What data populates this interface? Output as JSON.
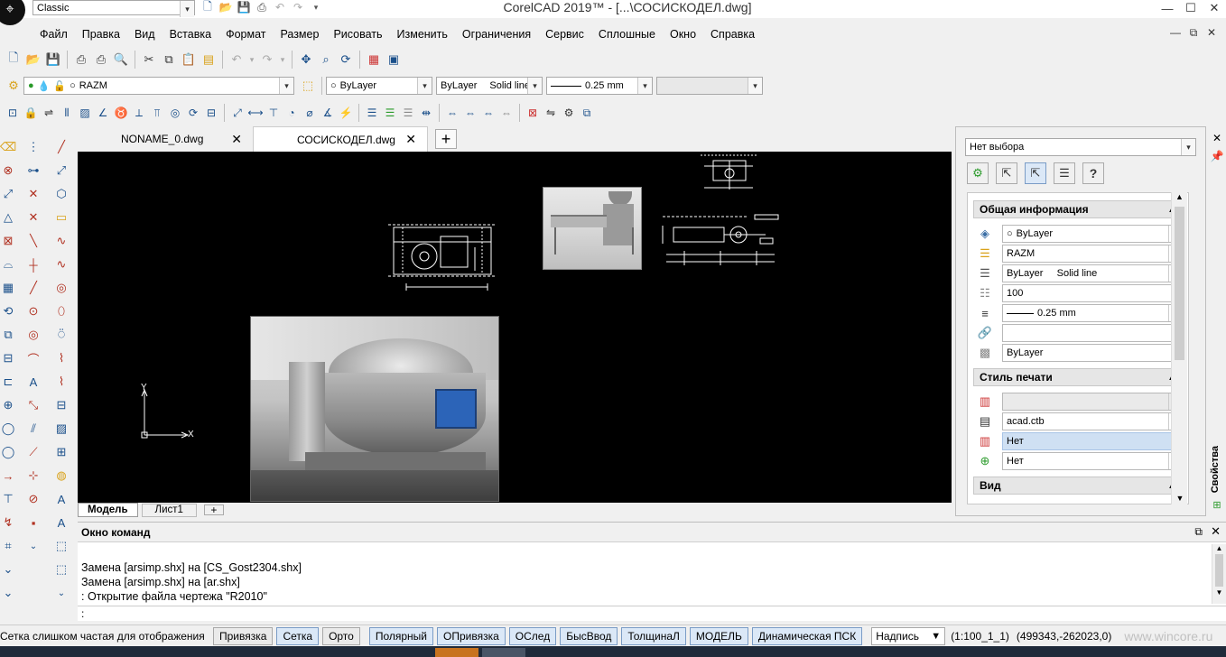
{
  "window": {
    "title": "CorelCAD 2019™ - [...\\СОСИСКОДЕЛ.dwg]",
    "workspace": "Classic",
    "controls": [
      "—",
      "☐",
      "✕"
    ],
    "doc_controls": [
      "—",
      "⧉",
      "✕"
    ]
  },
  "menu": [
    "Файл",
    "Правка",
    "Вид",
    "Вставка",
    "Формат",
    "Размер",
    "Рисовать",
    "Изменить",
    "Ограничения",
    "Сервис",
    "Сплошные",
    "Окно",
    "Справка"
  ],
  "layer_toolbar": {
    "layer": "RAZM",
    "color": "ByLayer",
    "linetype_a": "ByLayer",
    "linetype_b": "Solid line",
    "lineweight": "0.25 mm"
  },
  "tabs": [
    {
      "label": "NONAME_0.dwg",
      "active": false
    },
    {
      "label": "СОСИСКОДЕЛ.dwg",
      "active": true
    }
  ],
  "tab_add": "+",
  "layout_tabs": [
    {
      "label": "Модель",
      "active": true
    },
    {
      "label": "Лист1",
      "active": false
    }
  ],
  "canvas": {
    "axis_y": "Y",
    "axis_x": "X"
  },
  "properties": {
    "selection": "Нет выбора",
    "help": "?",
    "side_label": "Свойства",
    "general_title": "Общая информация",
    "general": [
      "ByLayer",
      "RAZM",
      "ByLayer     Solid line",
      "100",
      "0.25 mm",
      "",
      "ByLayer"
    ],
    "print_title": "Стиль печати",
    "print": [
      "",
      "acad.ctb",
      "Нет",
      "Нет"
    ],
    "view_title": "Вид"
  },
  "command": {
    "title": "Окно команд",
    "lines": [
      "Замена [arsimp.shx] на [CS_Gost2304.shx]",
      "Замена [arsimp.shx] на [ar.shx]",
      ": Открытие файла чертежа \"R2010\""
    ],
    "prompt": ":"
  },
  "status": {
    "message": "Сетка слишком частая для отображения",
    "buttons": [
      {
        "label": "Привязка",
        "on": false
      },
      {
        "label": "Сетка",
        "on": true
      },
      {
        "label": "Орто",
        "on": false
      },
      {
        "label": "Полярный",
        "on": true
      },
      {
        "label": "ОПривязка",
        "on": true
      },
      {
        "label": "ОСлед",
        "on": true
      },
      {
        "label": "БысВвод",
        "on": true
      },
      {
        "label": "ТолщинаЛ",
        "on": true
      },
      {
        "label": "МОДЕЛЬ",
        "on": true
      },
      {
        "label": "Динамическая ПСК",
        "on": true
      }
    ],
    "annotation": "Надпись",
    "scale": "(1:100_1_1)",
    "coords": "(499343,-262023,0)",
    "watermark": "www.wincore.ru"
  }
}
